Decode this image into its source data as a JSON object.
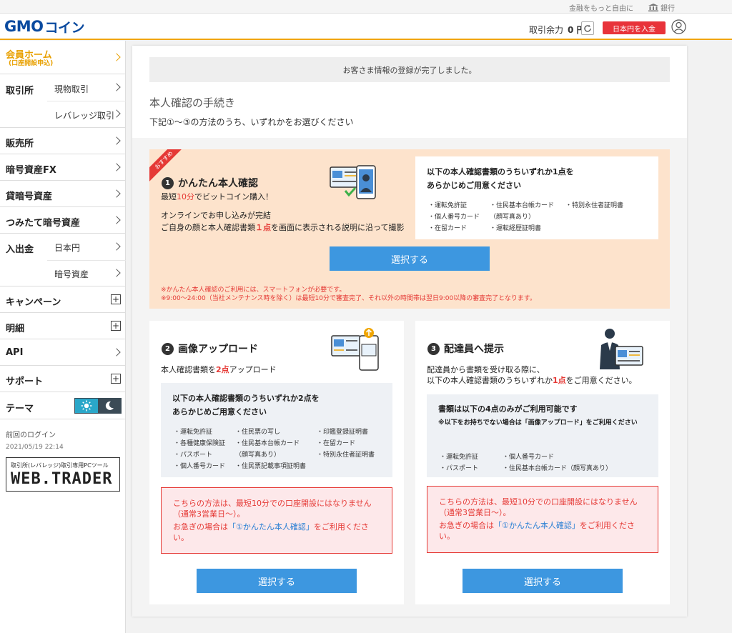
{
  "topbar": {
    "tagline": "金融をもっと自由に",
    "bank_label": "銀行"
  },
  "header": {
    "logo_latin": "GMO",
    "logo_jp": "コイン",
    "balance_label": "取引余力",
    "balance_value": "0 円",
    "deposit_button": "日本円を入金"
  },
  "sidebar": {
    "home_label": "会員ホーム",
    "home_sub": "(口座開設申込)",
    "exchange_label": "取引所",
    "exchange_spot": "現物取引",
    "exchange_leverage": "レバレッジ取引",
    "sales_label": "販売所",
    "fx_label": "暗号資産FX",
    "lending_label": "貸暗号資産",
    "tsumitate_label": "つみたて暗号資産",
    "deposit_label": "入出金",
    "deposit_jpy": "日本円",
    "deposit_crypto": "暗号資産",
    "campaign_label": "キャンペーン",
    "details_label": "明細",
    "api_label": "API",
    "support_label": "サポート",
    "theme_label": "テーマ",
    "last_login_label": "前回のログイン",
    "last_login_time": "2021/05/19 22:14",
    "webtrader_caption": "取引所(レバレッジ)取引専用PCツール",
    "webtrader_logo": "WEB.TRADER"
  },
  "main": {
    "notice": "お客さま情報の登録が完了しました。",
    "title": "本人確認の手続き",
    "subtitle": "下記①～③の方法のうち、いずれかをお選びください",
    "option1": {
      "ribbon": "おすすめ",
      "number": "1",
      "title": "かんたん本人確認",
      "promo_pre": "最短",
      "promo_red": "10分",
      "promo_post": "でビットコイン購入！",
      "desc1": "オンラインでお申し込みが完結",
      "desc2_pre": "ご自身の顔と本人確認書類",
      "desc2_red": "１点",
      "desc2_post": "を画面に表示される説明に沿って撮影",
      "box_title1": "以下の本人確認書類のうちいずれか1点を",
      "box_title2": "あらかじめご用意ください",
      "docs": [
        "・運転免許証",
        "・住民基本台帳カード",
        "・特別永住者証明書",
        "・個人番号カード",
        "（顔写真あり）",
        "・在留カード",
        "・運転経歴証明書"
      ],
      "button": "選択する",
      "note1": "※かんたん本人確認のご利用には、スマートフォンが必要です。",
      "note2": "※9:00～24:00（当社メンテナンス時を除く）は最短10分で審査完了、それ以外の時間帯は翌日9:00以降の審査完了となります。"
    },
    "option2": {
      "number": "2",
      "title": "画像アップロード",
      "desc_pre": "本人確認書類を",
      "desc_red": "2点",
      "desc_post": "アップロード",
      "box_title1": "以下の本人確認書類のうちいずれか2点を",
      "box_title2": "あらかじめご用意ください",
      "docs": [
        "・運転免許証",
        "・住民票の写し",
        "・印鑑登録証明書",
        "・各種健康保険証",
        "・住民基本台帳カード",
        "・在留カード",
        "・パスポート",
        "（顔写真あり）",
        "・特別永住者証明書",
        "・個人番号カード",
        "・住民票記載事項証明書"
      ],
      "warn1": "こちらの方法は、最短10分での口座開設にはなりません（通常3営業日～）。",
      "warn2_pre": "お急ぎの場合は",
      "warn2_link": "「①かんたん本人確認」",
      "warn2_post": "をご利用ください。",
      "button": "選択する"
    },
    "option3": {
      "number": "3",
      "title": "配達員へ提示",
      "desc1": "配達員から書類を受け取る際に、",
      "desc2_pre": "以下の本人確認書類のうちいずれか",
      "desc2_red": "1点",
      "desc2_post": "をご用意ください。",
      "box_title": "書類は以下の4点のみがご利用可能です",
      "box_note": "※以下をお持ちでない場合は「画像アップロード」をご利用ください",
      "docs": [
        "・運転免許証",
        "・個人番号カード",
        "・パスポート",
        "・住民基本台帳カード（顔写真あり）"
      ],
      "warn1": "こちらの方法は、最短10分での口座開設にはなりません（通常3営業日～）。",
      "warn2_pre": "お急ぎの場合は",
      "warn2_link": "「①かんたん本人確認」",
      "warn2_post": "をご利用ください。",
      "button": "選択する"
    }
  },
  "colors": {
    "accent": "#f0a500",
    "button_blue": "#3d97e0",
    "alert_red": "#e53935",
    "option1_bg": "#fde3cc"
  }
}
